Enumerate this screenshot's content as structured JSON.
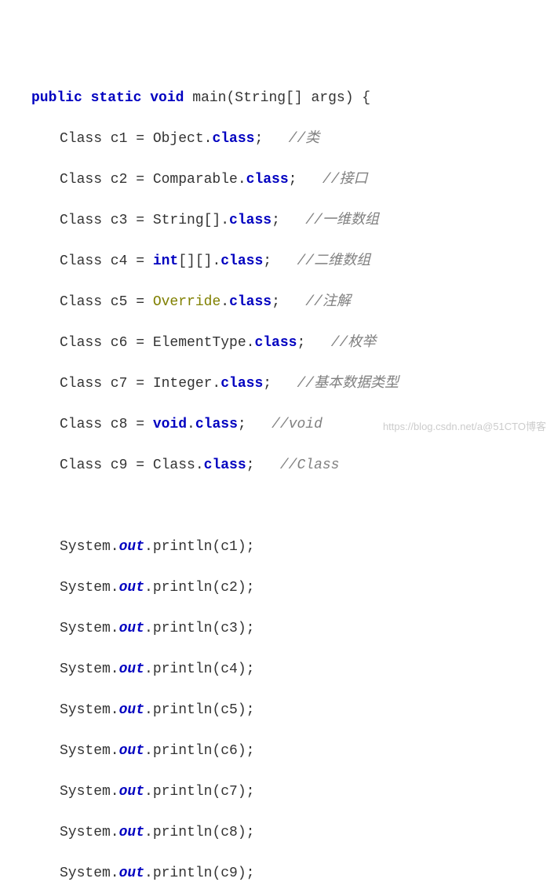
{
  "line1": {
    "k_public": "public",
    "k_static": "static",
    "k_void": "void",
    "rest": " main(String[] args) {"
  },
  "decl": [
    {
      "pre": "Class c1 = Object.",
      "cls": "class",
      "post": ";   ",
      "comment": "//类"
    },
    {
      "pre": "Class c2 = Comparable.",
      "cls": "class",
      "post": ";   ",
      "comment": "//接口"
    },
    {
      "pre": "Class c3 = String[].",
      "cls": "class",
      "post": ";   ",
      "comment": "//一维数组"
    },
    {
      "pre": "Class c4 = ",
      "kw_pre": "int",
      "mid": "[][].",
      "cls": "class",
      "post": ";   ",
      "comment": "//二维数组"
    },
    {
      "pre": "Class c5 = ",
      "anno": "Override",
      "mid": ".",
      "cls": "class",
      "post": ";   ",
      "comment": "//注解"
    },
    {
      "pre": "Class c6 = ElementType.",
      "cls": "class",
      "post": ";   ",
      "comment": "//枚举"
    },
    {
      "pre": "Class c7 = Integer.",
      "cls": "class",
      "post": ";   ",
      "comment": "//基本数据类型"
    },
    {
      "pre": "Class c8 = ",
      "kw_pre": "void",
      "mid": ".",
      "cls": "class",
      "post": ";   ",
      "comment": "//void"
    },
    {
      "pre": "Class c9 = Class.",
      "cls": "class",
      "post": ";   ",
      "comment": "//Class"
    }
  ],
  "print": [
    {
      "a": "System.",
      "out": "out",
      "b": ".println(c1);"
    },
    {
      "a": "System.",
      "out": "out",
      "b": ".println(c2);"
    },
    {
      "a": "System.",
      "out": "out",
      "b": ".println(c3);"
    },
    {
      "a": "System.",
      "out": "out",
      "b": ".println(c4);"
    },
    {
      "a": "System.",
      "out": "out",
      "b": ".println(c5);"
    },
    {
      "a": "System.",
      "out": "out",
      "b": ".println(c6);"
    },
    {
      "a": "System.",
      "out": "out",
      "b": ".println(c7);"
    },
    {
      "a": "System.",
      "out": "out",
      "b": ".println(c8);"
    },
    {
      "a": "System.",
      "out": "out",
      "b": ".println(c9);"
    }
  ],
  "watermark": "https://blog.csdn.net/a@51CTO博客"
}
